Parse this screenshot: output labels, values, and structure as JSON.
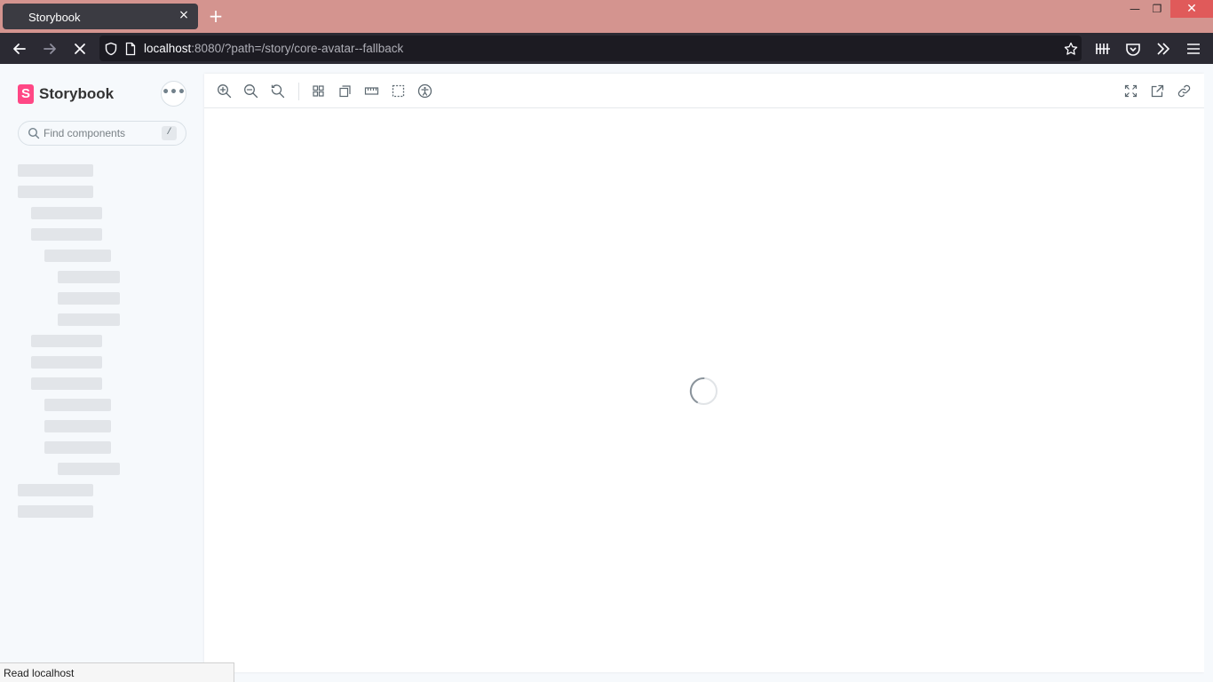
{
  "browser": {
    "tab_title": "Storybook",
    "tab_close_glyph": "×",
    "new_tab_glyph": "+",
    "window_controls": {
      "minimize": "—",
      "maximize": "❐",
      "close": "✕"
    },
    "url_host": "localhost",
    "url_rest": ":8080/?path=/story/core-avatar--fallback",
    "status_text": "Read localhost"
  },
  "sidebar": {
    "brand_logo_letter": "S",
    "brand_name": "Storybook",
    "menu_glyph": "•••",
    "search_placeholder": "Find components",
    "search_shortcut": "/"
  },
  "toolbar_icons": [
    "zoom-in-icon",
    "zoom-out-icon",
    "zoom-reset-icon",
    "grid-icon",
    "background-icon",
    "measure-icon",
    "outline-icon",
    "accessibility-icon"
  ],
  "toolbar_right_icons": [
    "fullscreen-icon",
    "open-new-tab-icon",
    "copy-link-icon"
  ],
  "state": "loading",
  "colors": {
    "tab_strip": "#d4948f",
    "nav_bar": "#2b2a33",
    "brand_accent": "#ff4785",
    "sidebar_bg": "#f6f9fc"
  }
}
